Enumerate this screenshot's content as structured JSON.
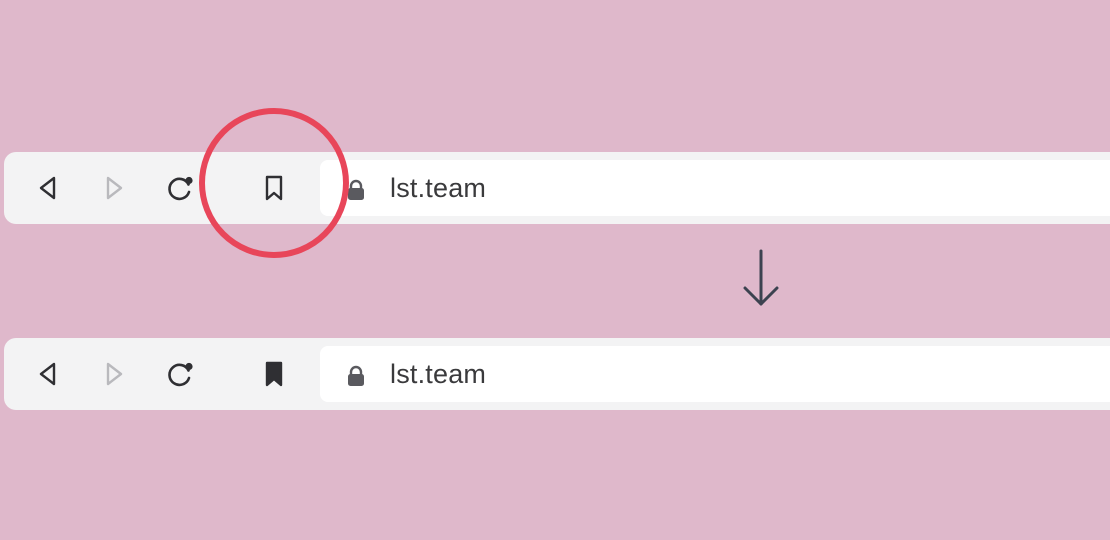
{
  "colors": {
    "background": "#dfb8cb",
    "toolbar": "#f3f3f4",
    "address_bar": "#ffffff",
    "icon_active": "#2f2f33",
    "icon_disabled": "#b9b9bd",
    "highlight_ring": "#e8465a",
    "arrow": "#3c4250"
  },
  "before": {
    "back_icon": "back-arrow-icon",
    "forward_icon": "forward-arrow-icon",
    "reload_icon": "reload-icon",
    "bookmark_icon": "bookmark-outline-icon",
    "bookmarked": false,
    "lock_icon": "lock-icon",
    "url": "lst.team"
  },
  "after": {
    "back_icon": "back-arrow-icon",
    "forward_icon": "forward-arrow-icon",
    "reload_icon": "reload-icon",
    "bookmark_icon": "bookmark-filled-icon",
    "bookmarked": true,
    "lock_icon": "lock-icon",
    "url": "lst.team"
  },
  "annotations": {
    "highlight": "circle-highlight-bookmark",
    "transition_arrow": "down-arrow-icon"
  }
}
